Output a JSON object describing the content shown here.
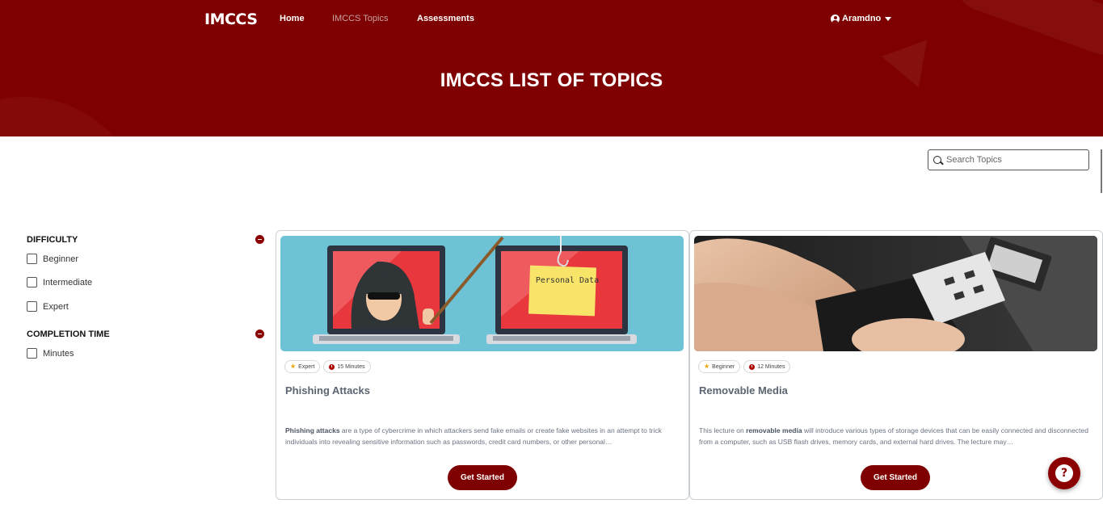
{
  "header": {
    "logo": "IMCCS",
    "nav": {
      "home": "Home",
      "topics": "IMCCS Topics",
      "assessments": "Assessments"
    },
    "user": {
      "name": "Aramdno",
      "icon": "user-circle-icon",
      "caret_icon": "caret-down-icon"
    },
    "page_title": "IMCCS LIST OF TOPICS"
  },
  "search": {
    "placeholder": "Search Topics",
    "value": "",
    "icon": "search-icon"
  },
  "filters": {
    "difficulty": {
      "title": "DIFFICULTY",
      "options": [
        "Beginner",
        "Intermediate",
        "Expert"
      ]
    },
    "completion_time": {
      "title": "COMPLETION TIME",
      "options": [
        "Minutes"
      ]
    }
  },
  "cards": [
    {
      "level": "Expert",
      "duration": "15 Minutes",
      "title": "Phishing Attacks",
      "desc_bold": "Phishing attacks",
      "desc_rest": " are a type of cybercrime in which attackers send fake emails or create fake websites in an attempt to trick individuals into revealing sensitive information such as passwords, credit card numbers, or other personal…",
      "image_text": "Personal Data",
      "button": "Get Started"
    },
    {
      "level": "Beginner",
      "duration": "12 Minutes",
      "title": "Removable Media",
      "desc_pre": "This lecture on ",
      "desc_bold": "removable media",
      "desc_rest": " will introduce various types of storage devices that can be easily connected and disconnected from a computer, such as USB flash drives, memory cards, and external hard drives. The lecture may…",
      "button": "Get Started"
    }
  ],
  "help": {
    "label": "?"
  },
  "colors": {
    "brand": "#7f0000",
    "accent_star": "#f0a500"
  }
}
